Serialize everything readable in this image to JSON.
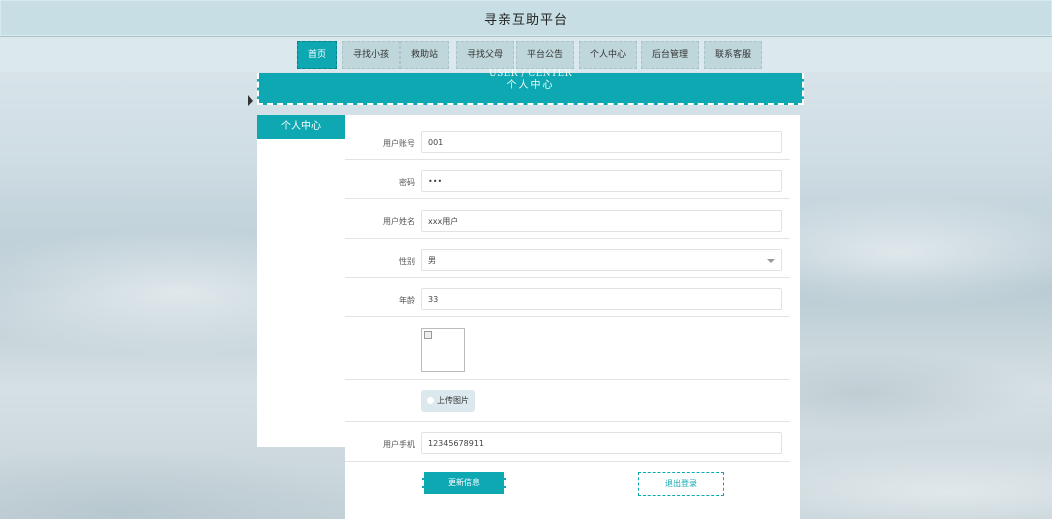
{
  "site": {
    "title": "寻亲互助平台"
  },
  "nav": [
    {
      "label": "首页"
    },
    {
      "label": "寻找小孩"
    },
    {
      "label": "救助站"
    },
    {
      "label": "寻找父母"
    },
    {
      "label": "平台公告"
    },
    {
      "label": "个人中心"
    },
    {
      "label": "后台管理"
    },
    {
      "label": "联系客服"
    }
  ],
  "banner": {
    "en": "USER / CENTER",
    "zh": "个人中心"
  },
  "sidebar": {
    "title": "个人中心"
  },
  "form": {
    "account": {
      "label": "用户账号",
      "value": "001"
    },
    "password": {
      "label": "密码",
      "value": "•••"
    },
    "name": {
      "label": "用户姓名",
      "value": "xxx用户"
    },
    "gender": {
      "label": "性别",
      "value": "男"
    },
    "age": {
      "label": "年龄",
      "value": "33"
    },
    "upload": {
      "label": "上传图片"
    },
    "phone": {
      "label": "用户手机",
      "value": "12345678911"
    }
  },
  "actions": {
    "update": "更新信息",
    "logout": "退出登录"
  },
  "colors": {
    "accent": "#0ea8b3"
  }
}
